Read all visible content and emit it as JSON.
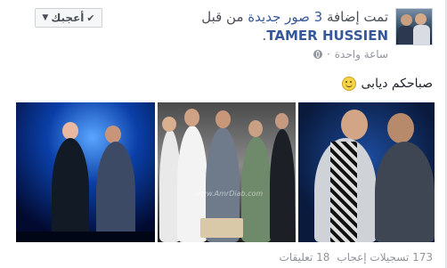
{
  "post": {
    "headline_pre": "تمت إضافة",
    "photo_count": "3",
    "headline_mid": "صور جديدة",
    "headline_post": "من قبل",
    "author": "TAMER HUSSIEN",
    "author_suffix": ".",
    "timestamp": "ساعة واحدة",
    "separator": "·",
    "like_button_label": "أعجبك",
    "status_text": "صباحكم ديابى",
    "likes_count": "173 تسجيلات إعجاب",
    "comments_count": "18 تعليقات",
    "photo_watermark": "www.AmrDiab.com"
  },
  "icons": {
    "privacy": "globe-icon",
    "emoji": "smiley-icon",
    "like_check": "check-icon",
    "dropdown": "chevron-down-icon"
  },
  "colors": {
    "link": "#365899",
    "muted": "#90949c",
    "text": "#1d2129"
  }
}
